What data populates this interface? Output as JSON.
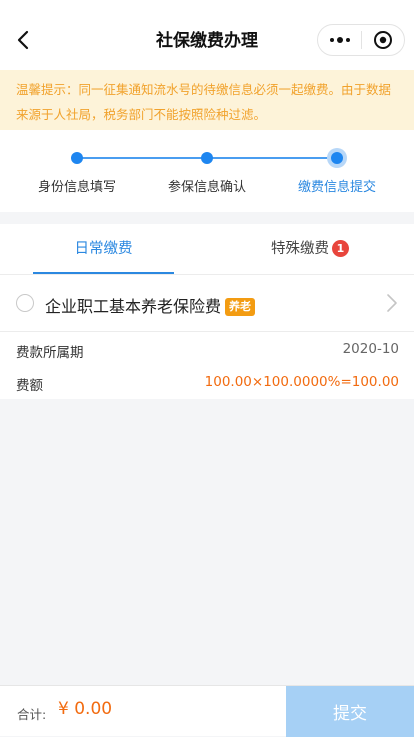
{
  "header": {
    "title": "社保缴费办理",
    "back_icon": "chevron-left-icon",
    "more_icon": "more-dots-icon",
    "close_icon": "target-icon"
  },
  "notice": {
    "text": "温馨提示：同一征集通知流水号的待缴信息必须一起缴费。由于数据来源于人社局，税务部门不能按照险种过滤。",
    "color": "#f1a22c",
    "background": "#fdf3d9"
  },
  "steps": {
    "items": [
      {
        "label": "身份信息填写"
      },
      {
        "label": "参保信息确认"
      },
      {
        "label": "缴费信息提交"
      }
    ],
    "active_index": 2,
    "accent": "#1e86f0"
  },
  "tabs": {
    "daily": {
      "label": "日常缴费"
    },
    "special": {
      "label": "特殊缴费",
      "badge": "1"
    },
    "active": "daily"
  },
  "item": {
    "name": "企业职工基本养老保险费",
    "tag": "养老",
    "rows": [
      {
        "key": "费款所属期",
        "value": "2020-10"
      },
      {
        "key": "费额",
        "value": "100.00×100.0000%=100.00"
      }
    ]
  },
  "footer": {
    "total_label": "合计:",
    "total_amount": "¥ 0.00",
    "submit_label": "提交"
  }
}
